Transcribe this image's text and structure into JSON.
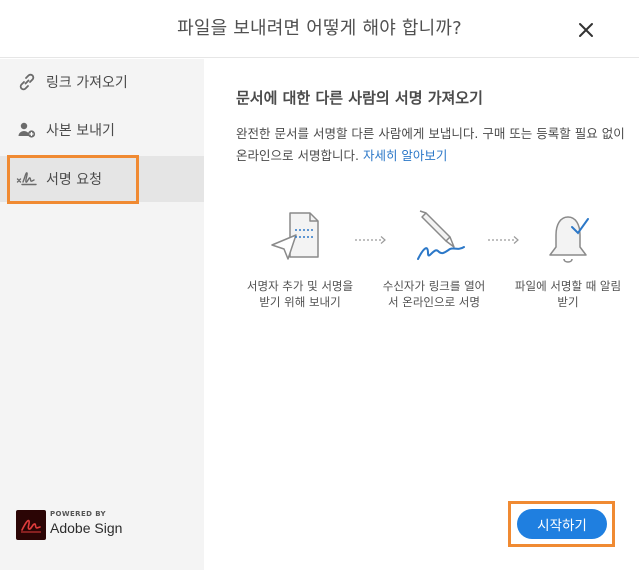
{
  "dialog": {
    "title": "파일을 보내려면 어떻게 해야 합니까?",
    "close_icon": "close-icon"
  },
  "sidebar": {
    "items": [
      {
        "label": "링크 가져오기",
        "icon": "link-icon",
        "active": false
      },
      {
        "label": "사본 보내기",
        "icon": "user-add-icon",
        "active": false
      },
      {
        "label": "서명 요청",
        "icon": "signature-icon",
        "active": true
      }
    ]
  },
  "brand": {
    "powered_by": "POWERED BY",
    "name": "Adobe Sign"
  },
  "content": {
    "title": "문서에 대한 다른 사람의 서명 가져오기",
    "description": "완전한 문서를 서명할 다른 사람에게 보냅니다. 구매 또는 등록할 필요 없이 온라인으로 서명합니다.",
    "learn_more": "자세히 알아보기",
    "steps": [
      {
        "label": "서명자 추가 및 서명을 받기 위해 보내기",
        "icon": "send-document-icon"
      },
      {
        "label": "수신자가 링크를 열어서 온라인으로 서명",
        "icon": "pen-signing-icon"
      },
      {
        "label": "파일에 서명할 때 알림 받기",
        "icon": "bell-check-icon"
      }
    ]
  },
  "actions": {
    "start_label": "시작하기"
  },
  "colors": {
    "accent": "#1f7fe0",
    "highlight": "#f08a32",
    "link": "#2c78c8",
    "sidebar_bg": "#f4f4f4",
    "active_bg": "#e5e5e5"
  }
}
